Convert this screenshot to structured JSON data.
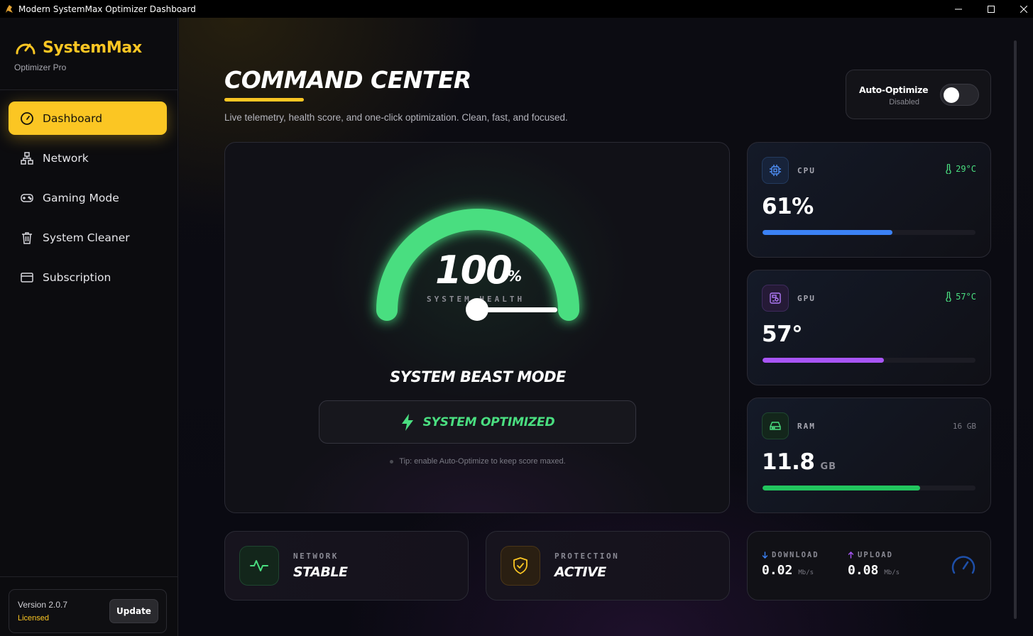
{
  "window": {
    "title": "Modern SystemMax Optimizer Dashboard"
  },
  "sidebar": {
    "brand": "SystemMax",
    "brand_sub": "Optimizer Pro",
    "items": [
      {
        "label": "Dashboard",
        "icon": "gauge-icon",
        "active": true
      },
      {
        "label": "Network",
        "icon": "network-icon",
        "active": false
      },
      {
        "label": "Gaming Mode",
        "icon": "gamepad-icon",
        "active": false
      },
      {
        "label": "System Cleaner",
        "icon": "trash-icon",
        "active": false
      },
      {
        "label": "Subscription",
        "icon": "credit-card-icon",
        "active": false
      }
    ],
    "version": "Version 2.0.7",
    "license": "Licensed",
    "update_label": "Update"
  },
  "header": {
    "title": "COMMAND CENTER",
    "subtitle": "Live telemetry, health score, and one-click optimization. Clean, fast, and focused.",
    "auto_optimize": {
      "label": "Auto-Optimize",
      "status": "Disabled",
      "enabled": false
    }
  },
  "health": {
    "value": "100",
    "unit": "%",
    "label": "SYSTEM HEALTH",
    "level": 1.0,
    "mode": "SYSTEM BEAST MODE",
    "button_label": "SYSTEM OPTIMIZED",
    "tip": "Tip: enable Auto-Optimize to keep score maxed."
  },
  "stats": {
    "cpu": {
      "name": "CPU",
      "temp": "29°C",
      "value": "61%",
      "level": 0.61,
      "color": "#3b82f6"
    },
    "gpu": {
      "name": "GPU",
      "temp": "57°C",
      "value": "57°",
      "level": 0.57,
      "color": "#a855f7"
    },
    "ram": {
      "name": "RAM",
      "total": "16 GB",
      "value": "11.8",
      "unit": "GB",
      "level": 0.74,
      "color": "#22c55e"
    }
  },
  "network": {
    "label": "NETWORK",
    "value": "STABLE"
  },
  "protection": {
    "label": "PROTECTION",
    "value": "ACTIVE"
  },
  "speed": {
    "download_label": "DOWNLOAD",
    "download_value": "0.02",
    "download_unit": "Mb/s",
    "upload_label": "UPLOAD",
    "upload_value": "0.08",
    "upload_unit": "Mb/s"
  },
  "colors": {
    "accent": "#fbc623",
    "success": "#4ade80"
  }
}
